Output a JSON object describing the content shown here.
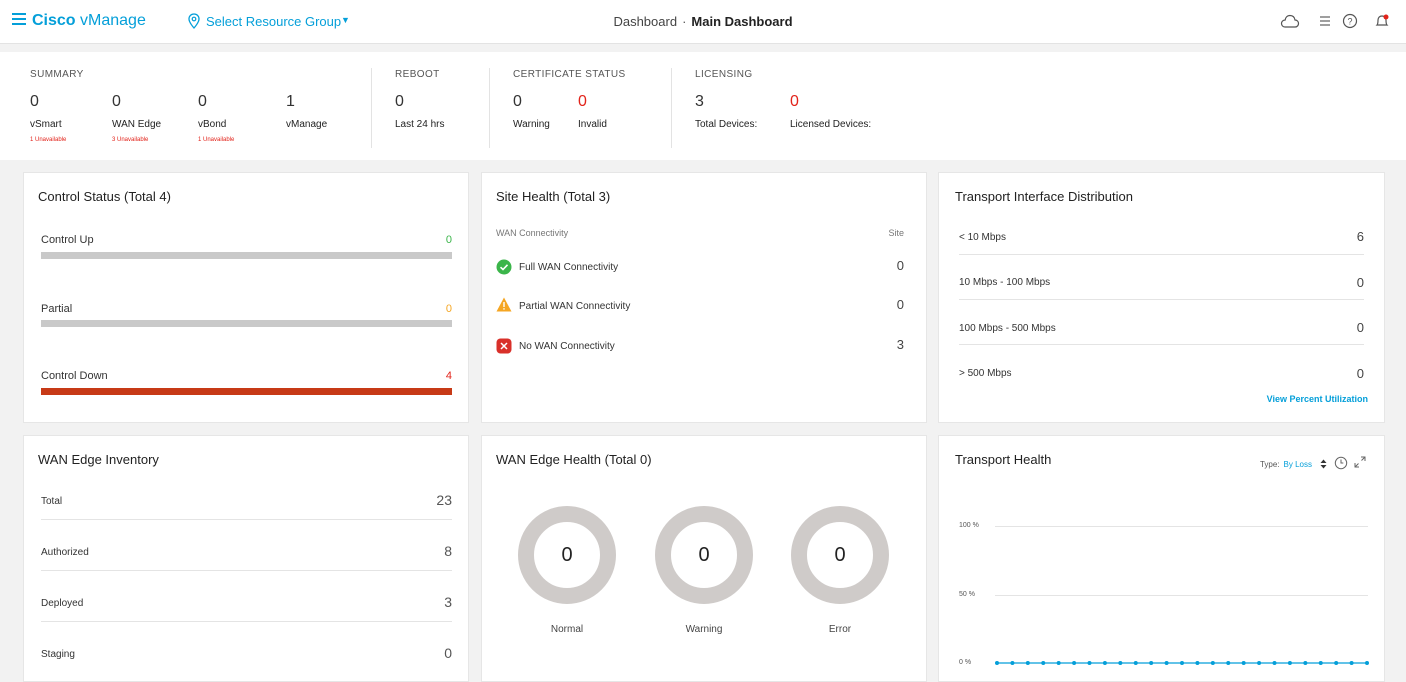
{
  "header": {
    "brand_bold": "Cisco",
    "brand_rest": " vManage",
    "resource_group": "Select Resource Group",
    "breadcrumb_parent": "Dashboard",
    "breadcrumb_sep": "·",
    "breadcrumb_current": "Main Dashboard",
    "icons": [
      "cloud-icon",
      "tasks-icon",
      "help-icon",
      "alarm-bell-icon"
    ]
  },
  "summary": {
    "summary_head": "SUMMARY",
    "items": [
      {
        "value": "0",
        "label": "vSmart",
        "sub": "1 Unavailable"
      },
      {
        "value": "0",
        "label": "WAN Edge",
        "sub": "3 Unavailable"
      },
      {
        "value": "0",
        "label": "vBond",
        "sub": "1 Unavailable"
      },
      {
        "value": "1",
        "label": "vManage",
        "sub": ""
      }
    ],
    "reboot": {
      "head": "REBOOT",
      "value": "0",
      "label": "Last 24 hrs"
    },
    "certificate": {
      "head": "CERTIFICATE STATUS",
      "warning_value": "0",
      "warning_label": "Warning",
      "invalid_value": "0",
      "invalid_label": "Invalid"
    },
    "licensing": {
      "head": "LICENSING",
      "total_value": "3",
      "total_label": "Total Devices:",
      "licensed_value": "0",
      "licensed_label": "Licensed Devices:"
    }
  },
  "control_status": {
    "title": "Control Status (Total 4)",
    "rows": [
      {
        "label": "Control Up",
        "value": "0",
        "color": "#3bb54a",
        "fill_fraction": 0
      },
      {
        "label": "Partial",
        "value": "0",
        "color": "#f5a623",
        "fill_fraction": 0
      },
      {
        "label": "Control Down",
        "value": "4",
        "color": "#e2231a",
        "fill_fraction": 1
      }
    ]
  },
  "site_health": {
    "title": "Site Health (Total 3)",
    "col_connectivity": "WAN Connectivity",
    "col_site": "Site",
    "rows": [
      {
        "label": "Full WAN Connectivity",
        "value": "0",
        "icon": "check-circle-icon"
      },
      {
        "label": "Partial WAN Connectivity",
        "value": "0",
        "icon": "warning-triangle-icon"
      },
      {
        "label": "No WAN Connectivity",
        "value": "3",
        "icon": "error-x-icon"
      }
    ]
  },
  "transport_interface": {
    "title": "Transport Interface Distribution",
    "rows": [
      {
        "label": "< 10 Mbps",
        "value": "6"
      },
      {
        "label": "10 Mbps - 100 Mbps",
        "value": "0"
      },
      {
        "label": "100 Mbps - 500 Mbps",
        "value": "0"
      },
      {
        "label": "> 500 Mbps",
        "value": "0"
      }
    ],
    "link": "View Percent Utilization"
  },
  "inventory": {
    "title": "WAN Edge Inventory",
    "rows": [
      {
        "label": "Total",
        "value": "23"
      },
      {
        "label": "Authorized",
        "value": "8"
      },
      {
        "label": "Deployed",
        "value": "3"
      },
      {
        "label": "Staging",
        "value": "0"
      }
    ]
  },
  "edge_health": {
    "title": "WAN Edge Health (Total 0)",
    "donuts": [
      {
        "label": "Normal",
        "value": "0"
      },
      {
        "label": "Warning",
        "value": "0"
      },
      {
        "label": "Error",
        "value": "0"
      }
    ]
  },
  "transport_health": {
    "title": "Transport Health",
    "type_label": "Type:",
    "type_value": "By Loss",
    "y_ticks": [
      "100 %",
      "50 %",
      "0 %"
    ],
    "series_values_percent": [
      0,
      0,
      0,
      0,
      0,
      0,
      0,
      0,
      0,
      0,
      0,
      0,
      0,
      0,
      0,
      0,
      0,
      0,
      0,
      0,
      0,
      0,
      0,
      0,
      0
    ],
    "series_color": "#049fd9"
  }
}
